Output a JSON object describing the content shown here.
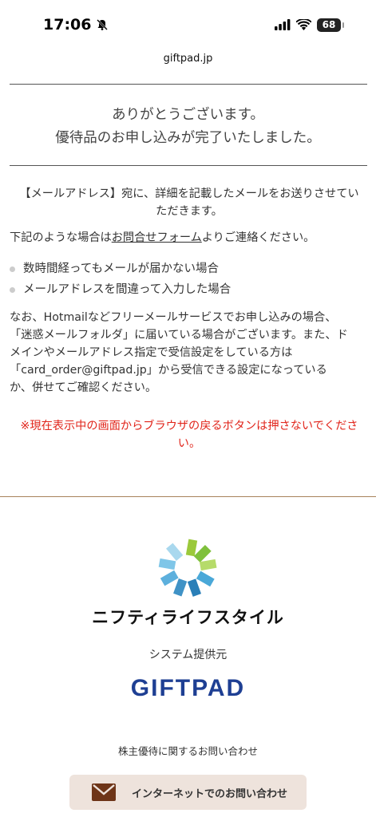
{
  "status": {
    "time": "17:06",
    "battery": "68"
  },
  "browser": {
    "url": "giftpad.jp"
  },
  "thanks": {
    "line1": "ありがとうございます。",
    "line2": "優待品のお申し込みが完了いたしました。"
  },
  "notice": {
    "email_line1": "【メールアドレス】宛に、詳細を記載したメールをお送りさせてい",
    "email_line2": "ただきます。",
    "contact_prefix": "下記のような場合は",
    "contact_link": "お問合せフォーム",
    "contact_suffix": "よりご連絡ください。",
    "bullets": [
      "数時間経ってもメールが届かない場合",
      "メールアドレスを間違って入力した場合"
    ],
    "spam_lines": [
      "なお、Hotmailなどフリーメールサービスでお申し込みの場合、",
      "「迷惑メールフォルダ」に届いている場合がございます。また、ド",
      "メインやメールアドレス指定で受信設定をしている方は",
      "「card_order@giftpad.jp」から受信できる設定になっている",
      "か、併せてご確認ください。"
    ],
    "warning_line1": "※現在表示中の画面からブラウザの戻るボタンは押さないでくださ",
    "warning_line2": "い。"
  },
  "footer": {
    "brand": "ニフティライフスタイル",
    "system_label": "システム提供元",
    "giftpad_logo": "GIFTPAD",
    "contact_label": "株主優待に関するお問い合わせ",
    "contact_button": "インターネットでのお問い合わせ",
    "contact_button_icon": "envelope-icon",
    "warning_color": "#e1251b",
    "giftpad_color": "#1e3f93"
  }
}
